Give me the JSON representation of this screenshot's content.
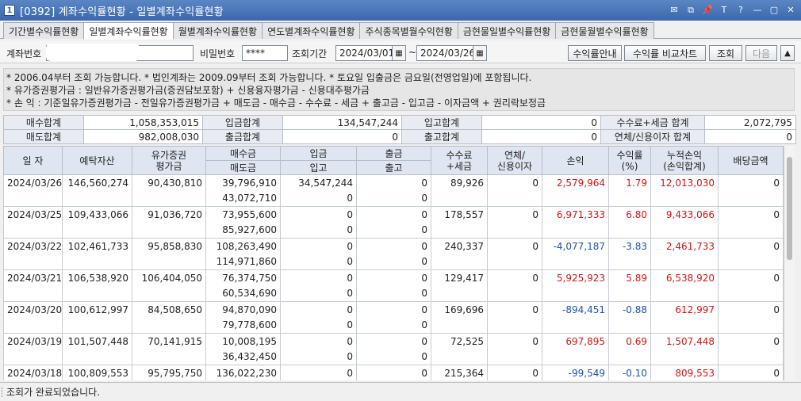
{
  "window": {
    "app_icon": "1",
    "title": "[0392] 계좌수익률현황 - 일별계좌수익률현황",
    "controls": [
      "✉",
      "⧉",
      "📌",
      "T",
      "?",
      "—",
      "▢",
      "✕"
    ]
  },
  "tabs": [
    {
      "label": "기간별수익률현황",
      "active": false
    },
    {
      "label": "일별계좌수익률현황",
      "active": true
    },
    {
      "label": "월별계좌수익률현황",
      "active": false
    },
    {
      "label": "연도별계좌수익률현황",
      "active": false
    },
    {
      "label": "주식종목별월수익현황",
      "active": false
    },
    {
      "label": "금현물일별수익률현황",
      "active": false
    },
    {
      "label": "금현물월별수익률현황",
      "active": false
    }
  ],
  "toolbar": {
    "account_label": "계좌번호",
    "password_label": "비밀번호",
    "password_value": "****",
    "period_label": "조회기간",
    "date_from": "2024/03/01",
    "date_sep": "~",
    "date_to": "2024/03/26",
    "btn_guide": "수익률안내",
    "btn_compare": "수익률 비교차트",
    "btn_search": "조회",
    "btn_next": "다음",
    "btn_up": "▲",
    "calendar_icon": "▦",
    "dropdown_icon": "▼"
  },
  "notes": [
    "* 2006.04부터 조회 가능합니다.   * 법인계좌는 2009.09부터 조회 가능합니다.   * 토요일 입출금은 금요일(전영업일)에 포함됩니다.",
    "* 유가증권평가금 : 일반유가증권평가금(증권담보포함) + 신용융자평가금 - 신용대주평가금",
    "* 손         익 : 기준일유가증권평가금 - 전일유가증권평가금 + 매도금 - 매수금 - 수수료 - 세금 + 출고금 - 입고금 - 이자금액 + 권리락보정금"
  ],
  "summary": {
    "row1": [
      {
        "label": "매수합계",
        "value": "1,058,353,015"
      },
      {
        "label": "입금합계",
        "value": "134,547,244"
      },
      {
        "label": "입고합계",
        "value": "0"
      },
      {
        "label": "수수료+세금 합계",
        "value": "2,072,795"
      }
    ],
    "row2": [
      {
        "label": "매도합계",
        "value": "982,008,030"
      },
      {
        "label": "출금합계",
        "value": "0"
      },
      {
        "label": "출고합계",
        "value": "0"
      },
      {
        "label": "연체/신용이자 합계",
        "value": "0"
      }
    ]
  },
  "grid": {
    "headers": {
      "date": "일 자",
      "deposit_assets": "예탁자산",
      "securities_eval": [
        "유가증권",
        "평가금"
      ],
      "buy": "매수금",
      "sell": "매도금",
      "deposit_in": "입금",
      "stock_in": "입고",
      "withdraw": "출금",
      "stock_out": "출고",
      "fee_tax": [
        "수수료",
        "+세금"
      ],
      "interest": [
        "연체/",
        "신용이자"
      ],
      "pnl": "손익",
      "return_rate": [
        "수익률",
        "(%)"
      ],
      "cum_pnl": [
        "누적손익",
        "(손익합계)"
      ],
      "dividend": "배당금액"
    },
    "rows": [
      {
        "date": "2024/03/26",
        "deposit_assets": "146,560,274",
        "securities_eval": "90,430,810",
        "buy": "39,796,910",
        "sell": "43,072,710",
        "deposit_in": "34,547,244",
        "stock_in": "0",
        "withdraw": "0",
        "stock_out": "0",
        "fee_tax": "89,926",
        "interest": "0",
        "pnl": "2,579,964",
        "return_rate": "1.79",
        "cum_pnl": "12,013,030",
        "dividend": "0",
        "sign": "pos",
        "cum_sign": "pos"
      },
      {
        "date": "2024/03/25",
        "deposit_assets": "109,433,066",
        "securities_eval": "91,036,720",
        "buy": "73,955,600",
        "sell": "85,927,600",
        "deposit_in": "0",
        "stock_in": "0",
        "withdraw": "0",
        "stock_out": "0",
        "fee_tax": "178,557",
        "interest": "0",
        "pnl": "6,971,333",
        "return_rate": "6.80",
        "cum_pnl": "9,433,066",
        "dividend": "0",
        "sign": "pos",
        "cum_sign": "pos"
      },
      {
        "date": "2024/03/22",
        "deposit_assets": "102,461,733",
        "securities_eval": "95,858,830",
        "buy": "108,263,490",
        "sell": "114,971,860",
        "deposit_in": "0",
        "stock_in": "0",
        "withdraw": "0",
        "stock_out": "0",
        "fee_tax": "240,337",
        "interest": "0",
        "pnl": "-4,077,187",
        "return_rate": "-3.83",
        "cum_pnl": "2,461,733",
        "dividend": "0",
        "sign": "neg",
        "cum_sign": "pos"
      },
      {
        "date": "2024/03/21",
        "deposit_assets": "106,538,920",
        "securities_eval": "106,404,050",
        "buy": "76,374,750",
        "sell": "60,534,690",
        "deposit_in": "0",
        "stock_in": "0",
        "withdraw": "0",
        "stock_out": "0",
        "fee_tax": "129,417",
        "interest": "0",
        "pnl": "5,925,923",
        "return_rate": "5.89",
        "cum_pnl": "6,538,920",
        "dividend": "0",
        "sign": "pos",
        "cum_sign": "pos"
      },
      {
        "date": "2024/03/20",
        "deposit_assets": "100,612,997",
        "securities_eval": "84,508,650",
        "buy": "94,870,090",
        "sell": "79,778,600",
        "deposit_in": "0",
        "stock_in": "0",
        "withdraw": "0",
        "stock_out": "0",
        "fee_tax": "169,696",
        "interest": "0",
        "pnl": "-894,451",
        "return_rate": "-0.88",
        "cum_pnl": "612,997",
        "dividend": "0",
        "sign": "neg",
        "cum_sign": "pos"
      },
      {
        "date": "2024/03/19",
        "deposit_assets": "101,507,448",
        "securities_eval": "70,141,915",
        "buy": "10,008,195",
        "sell": "36,432,450",
        "deposit_in": "0",
        "stock_in": "0",
        "withdraw": "0",
        "stock_out": "0",
        "fee_tax": "72,525",
        "interest": "0",
        "pnl": "697,895",
        "return_rate": "0.69",
        "cum_pnl": "1,507,448",
        "dividend": "0",
        "sign": "pos",
        "cum_sign": "pos"
      },
      {
        "date": "2024/03/18",
        "deposit_assets": "100,809,553",
        "securities_eval": "95,795,750",
        "buy": "136,022,230",
        "sell": "",
        "deposit_in": "0",
        "stock_in": "",
        "withdraw": "0",
        "stock_out": "",
        "fee_tax": "215,364",
        "interest": "0",
        "pnl": "-99,549",
        "return_rate": "-0.10",
        "cum_pnl": "809,553",
        "dividend": "0",
        "sign": "neg",
        "cum_sign": "pos"
      }
    ]
  },
  "status": {
    "message": "조회가 완료되었습니다."
  }
}
